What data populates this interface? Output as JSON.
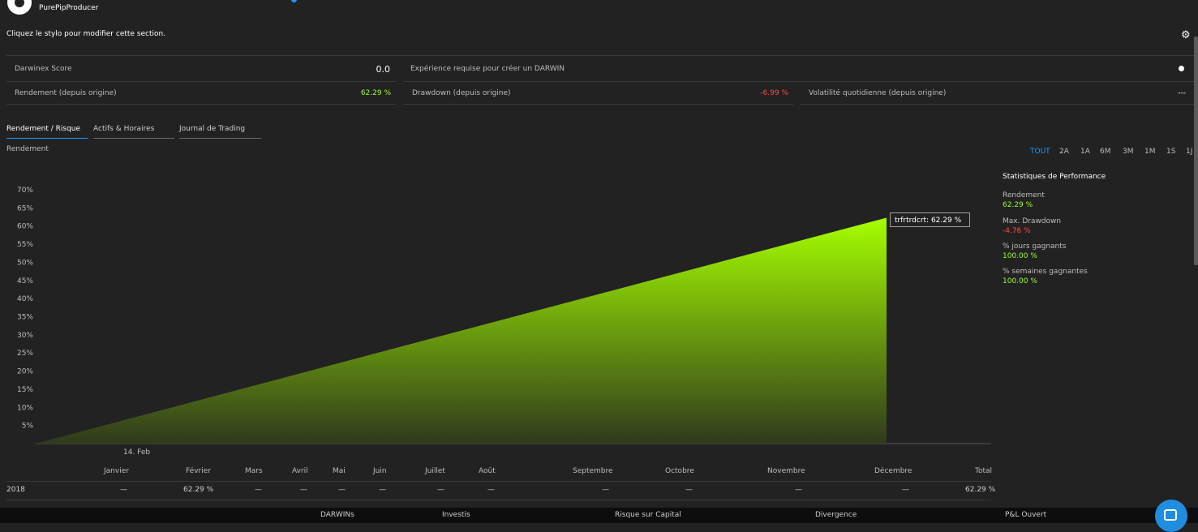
{
  "header": {
    "producer_name": "PurePipProducer",
    "edit_hint": "Cliquez le stylo pour modifier cette section."
  },
  "metrics": {
    "darwinex_score": {
      "label": "Darwinex Score",
      "value": "0.0"
    },
    "experience": {
      "label": "Expérience requise pour créer un DARWIN"
    },
    "return_since_origin": {
      "label": "Rendement (depuis origine)",
      "value": "62.29 %"
    },
    "drawdown_since_origin": {
      "label": "Drawdown (depuis origine)",
      "value": "-6.99 %"
    },
    "daily_volatility": {
      "label": "Volatilité quotidienne (depuis origine)",
      "value": "---"
    }
  },
  "tabs": [
    {
      "label": "Rendement / Risque",
      "active": true
    },
    {
      "label": "Actifs & Horaires",
      "active": false
    },
    {
      "label": "Journal de Trading",
      "active": false
    }
  ],
  "section_label": "Rendement",
  "periods": [
    {
      "label": "TOUT",
      "active": true
    },
    {
      "label": "2A"
    },
    {
      "label": "1A"
    },
    {
      "label": "6M"
    },
    {
      "label": "3M"
    },
    {
      "label": "1M"
    },
    {
      "label": "1S"
    },
    {
      "label": "1J"
    }
  ],
  "chart_data": {
    "type": "area",
    "y_ticks": [
      "5%",
      "10%",
      "15%",
      "20%",
      "25%",
      "30%",
      "35%",
      "40%",
      "45%",
      "50%",
      "55%",
      "60%",
      "65%",
      "70%"
    ],
    "ylim": [
      0,
      70
    ],
    "x_tick_label": "14. Feb",
    "points": [
      {
        "x": 0,
        "y": 0
      },
      {
        "x": 1,
        "y": 62.29
      }
    ],
    "grid": false,
    "tooltip": "trfrtrdcrt: 62.29 %",
    "colors": {
      "top": "#a6ff00",
      "bottom": "#2f3a1c"
    }
  },
  "performance_stats": {
    "title": "Statistiques de Performance",
    "items": [
      {
        "label": "Rendement",
        "value": "62.29 %",
        "color": "green"
      },
      {
        "label": "Max. Drawdown",
        "value": "-4.76 %",
        "color": "red"
      },
      {
        "label": "% jours gagnants",
        "value": "100.00 %",
        "color": "green"
      },
      {
        "label": "% semaines gagnantes",
        "value": "100.00 %",
        "color": "green"
      }
    ]
  },
  "monthly_table": {
    "headers": [
      "Janvier",
      "Février",
      "Mars",
      "Avril",
      "Mai",
      "Juin",
      "Juillet",
      "Août",
      "Septembre",
      "Octobre",
      "Novembre",
      "Décembre",
      "Total"
    ],
    "rows": [
      {
        "year": "2018",
        "values": [
          "—",
          "62.29 %",
          "—",
          "—",
          "—",
          "—",
          "—",
          "—",
          "—",
          "—",
          "—",
          "—",
          "62.29 %"
        ]
      }
    ]
  },
  "footer": {
    "items": [
      "DARWINs",
      "Investis",
      "Risque sur Capital",
      "Divergence",
      "P&L Ouvert"
    ]
  },
  "colors": {
    "background": "#222222",
    "positive": "#9cff2e",
    "negative": "#ff4a4a",
    "accent": "#1e9bff"
  }
}
